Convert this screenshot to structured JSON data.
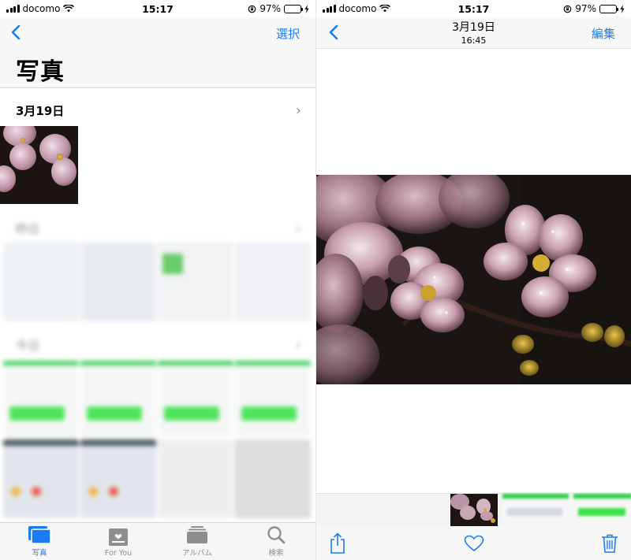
{
  "status": {
    "carrier": "docomo",
    "time": "15:17",
    "battery": "97%",
    "battery_level": 0.97
  },
  "left": {
    "nav": {
      "action": "選択"
    },
    "title": "写真",
    "sections": [
      {
        "date": "3月19日"
      },
      {
        "date": "昨日"
      },
      {
        "date": "今日"
      }
    ],
    "tabs": [
      {
        "label": "写真",
        "icon": "photos-icon",
        "active": true
      },
      {
        "label": "For You",
        "icon": "for-you-icon",
        "active": false
      },
      {
        "label": "アルバム",
        "icon": "albums-icon",
        "active": false
      },
      {
        "label": "検索",
        "icon": "search-icon",
        "active": false
      }
    ]
  },
  "right": {
    "nav": {
      "date": "3月19日",
      "time": "16:45",
      "action": "編集"
    },
    "toolbar": {
      "share": "share-icon",
      "favorite": "heart-icon",
      "delete": "trash-icon"
    }
  },
  "colors": {
    "accent": "#1a7cf5",
    "battery": "#3bc43e"
  }
}
